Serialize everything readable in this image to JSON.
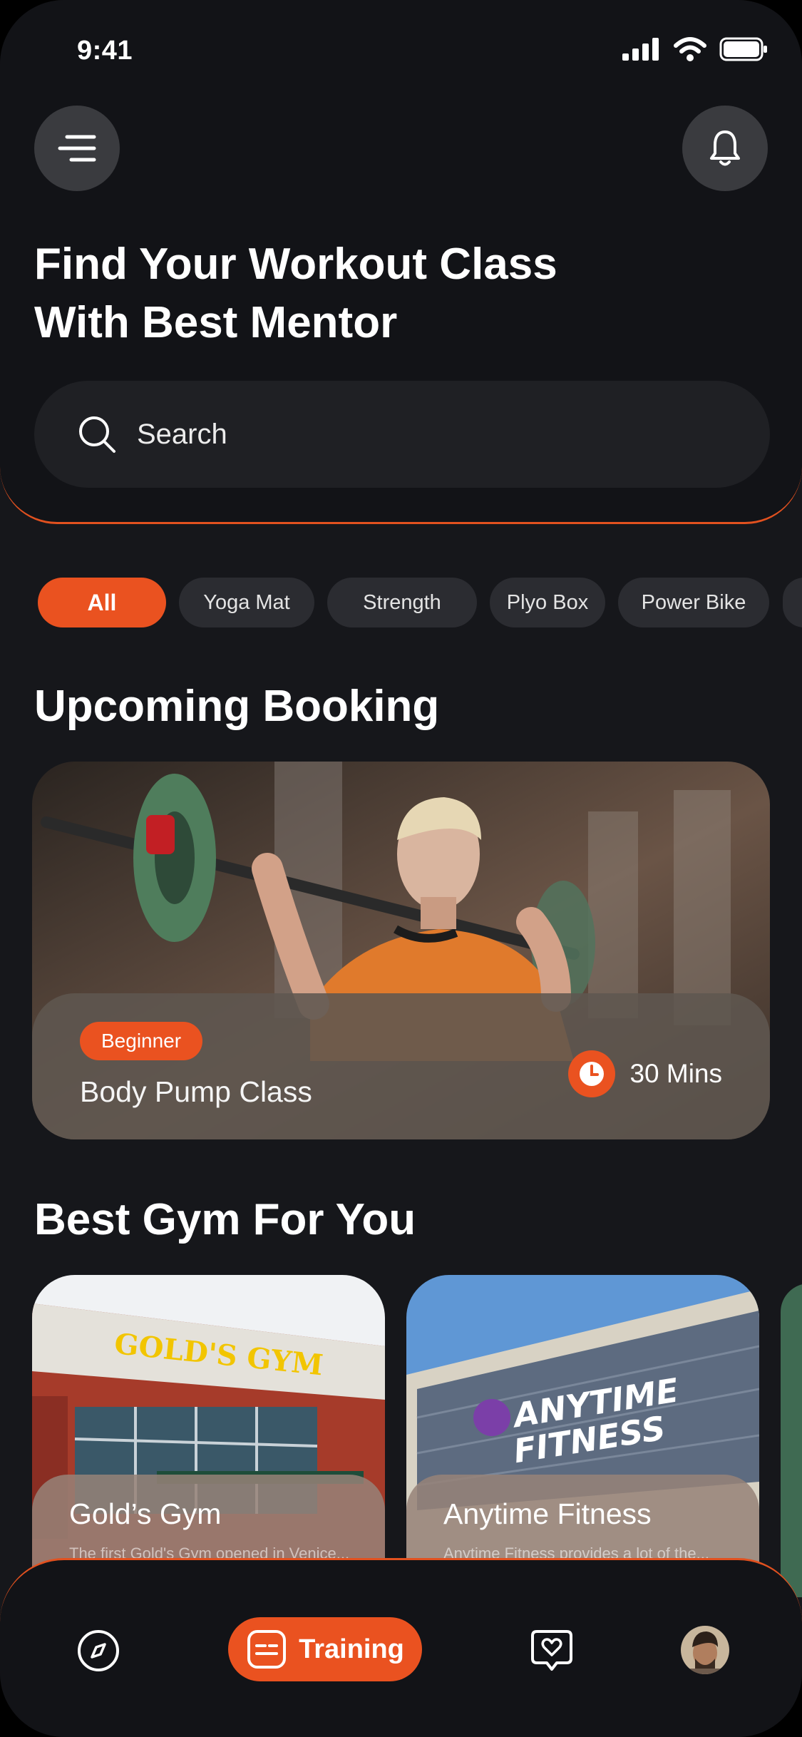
{
  "status_bar": {
    "time": "9:41",
    "icons": [
      "signal-icon",
      "wifi-icon",
      "battery-icon"
    ]
  },
  "header": {
    "menu_icon": "hamburger-menu-icon",
    "notification_icon": "bell-icon",
    "title_line1": "Find Your Workout Class",
    "title_line2": "With Best Mentor"
  },
  "search": {
    "placeholder": "Search",
    "icon": "search-icon"
  },
  "filters": [
    {
      "label": "All",
      "active": true
    },
    {
      "label": "Yoga Mat",
      "active": false
    },
    {
      "label": "Strength",
      "active": false
    },
    {
      "label": "Plyo Box",
      "active": false
    },
    {
      "label": "Power Bike",
      "active": false
    }
  ],
  "upcoming": {
    "title": "Upcoming Booking",
    "card": {
      "level": "Beginner",
      "class_name": "Body Pump Class",
      "duration": "30 Mins"
    }
  },
  "best_gym": {
    "title": "Best Gym For You",
    "gyms": [
      {
        "name": "Gold’s Gym",
        "sign": "GOLD'S GYM",
        "desc": "The first Gold's Gym opened in Venice..."
      },
      {
        "name": "Anytime Fitness",
        "sign_line1": "ANYTIME",
        "sign_line2": "FITNESS",
        "desc": "Anytime Fitness provides a lot of the..."
      }
    ]
  },
  "tab_bar": {
    "items": [
      {
        "name": "explore",
        "icon": "compass-icon"
      },
      {
        "name": "training",
        "icon": "training-icon",
        "label": "Training",
        "active": true
      },
      {
        "name": "favorites",
        "icon": "heart-chat-icon"
      },
      {
        "name": "profile",
        "icon": "avatar"
      }
    ]
  },
  "colors": {
    "accent": "#EA5220",
    "background": "#16171B",
    "surface": "#1F2024",
    "chip": "#2B2C31"
  }
}
